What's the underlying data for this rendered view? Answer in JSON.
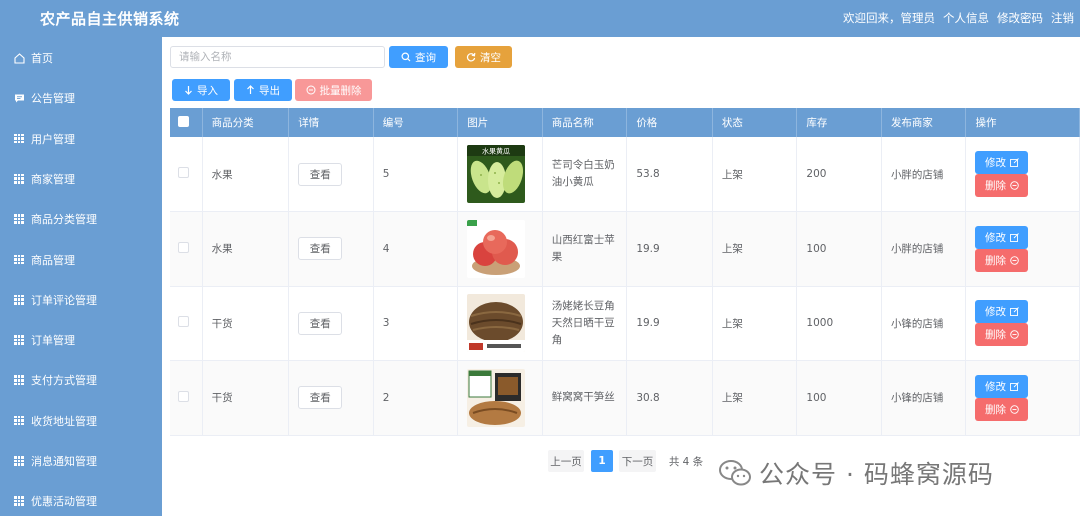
{
  "header": {
    "title": "农产品自主供销系统",
    "welcome": "欢迎回来，管理员",
    "links": [
      "个人信息",
      "修改密码",
      "注销"
    ]
  },
  "sidebar": {
    "items": [
      {
        "label": "首页",
        "icon": "home-icon"
      },
      {
        "label": "公告管理",
        "icon": "chat-icon"
      },
      {
        "label": "用户管理",
        "icon": "grid-icon"
      },
      {
        "label": "商家管理",
        "icon": "grid-icon"
      },
      {
        "label": "商品分类管理",
        "icon": "grid-icon"
      },
      {
        "label": "商品管理",
        "icon": "grid-icon"
      },
      {
        "label": "订单评论管理",
        "icon": "grid-icon"
      },
      {
        "label": "订单管理",
        "icon": "grid-icon"
      },
      {
        "label": "支付方式管理",
        "icon": "grid-icon"
      },
      {
        "label": "收货地址管理",
        "icon": "grid-icon"
      },
      {
        "label": "消息通知管理",
        "icon": "grid-icon"
      },
      {
        "label": "优惠活动管理",
        "icon": "grid-icon"
      }
    ]
  },
  "toolbar": {
    "search_placeholder": "请输入名称",
    "search_value": "",
    "query_label": "查询",
    "clear_label": "清空",
    "import_label": "导入",
    "export_label": "导出",
    "batch_delete_label": "批量删除"
  },
  "table": {
    "columns": [
      "商品分类",
      "详情",
      "编号",
      "图片",
      "商品名称",
      "价格",
      "状态",
      "库存",
      "发布商家",
      "操作"
    ],
    "view_label": "查看",
    "edit_label": "修改",
    "delete_label": "删除",
    "rows": [
      {
        "category": "水果",
        "id": "5",
        "name": "芒司令白玉奶油小黄瓜",
        "price": "53.8",
        "status": "上架",
        "stock": "200",
        "merchant": "小胖的店铺",
        "image": "cucumber",
        "image_text": "水果黄瓜"
      },
      {
        "category": "水果",
        "id": "4",
        "name": "山西红富士苹果",
        "price": "19.9",
        "status": "上架",
        "stock": "100",
        "merchant": "小胖的店铺",
        "image": "apple",
        "image_text": ""
      },
      {
        "category": "干货",
        "id": "3",
        "name": "汤姥姥长豆角天然日晒干豆角",
        "price": "19.9",
        "status": "上架",
        "stock": "1000",
        "merchant": "小锋的店铺",
        "image": "dried-beans",
        "image_text": ""
      },
      {
        "category": "干货",
        "id": "2",
        "name": "鲜窝窝干笋丝",
        "price": "30.8",
        "status": "上架",
        "stock": "100",
        "merchant": "小锋的店铺",
        "image": "bamboo-shoots",
        "image_text": ""
      }
    ]
  },
  "pagination": {
    "prev_label": "上一页",
    "current_page": "1",
    "next_label": "下一页",
    "total_label": "共 4 条"
  },
  "watermark": {
    "text": "公众号 · 码蜂窝源码"
  },
  "colors": {
    "header_bg": "#6a9ed3",
    "primary": "#409eff",
    "warning": "#e6a23c",
    "danger": "#f56c6c",
    "danger_light": "#f89898"
  }
}
